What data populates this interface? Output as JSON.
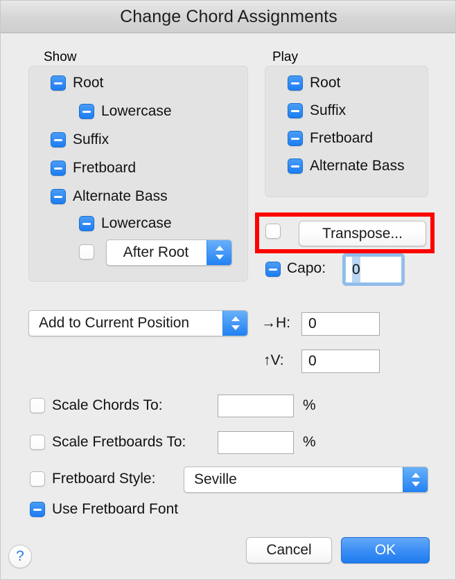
{
  "window": {
    "title": "Change Chord Assignments"
  },
  "show_group": {
    "label": "Show",
    "items": [
      {
        "label": "Root",
        "state": "mixed"
      },
      {
        "label": "Lowercase",
        "state": "mixed"
      },
      {
        "label": "Suffix",
        "state": "mixed"
      },
      {
        "label": "Fretboard",
        "state": "mixed"
      },
      {
        "label": "Alternate Bass",
        "state": "mixed"
      },
      {
        "label": "Lowercase",
        "state": "mixed"
      }
    ],
    "bass_position": {
      "checkbox_state": "off",
      "selected": "After Root"
    }
  },
  "play_group": {
    "label": "Play",
    "items": [
      {
        "label": "Root",
        "state": "mixed"
      },
      {
        "label": "Suffix",
        "state": "mixed"
      },
      {
        "label": "Fretboard",
        "state": "mixed"
      },
      {
        "label": "Alternate Bass",
        "state": "mixed"
      }
    ]
  },
  "transpose": {
    "checkbox_state": "off",
    "button_label": "Transpose...",
    "highlight_color": "#ff0000"
  },
  "capo": {
    "checkbox_state": "mixed",
    "label": "Capo:",
    "value": "0"
  },
  "position": {
    "mode_selected": "Add to Current Position",
    "h_label": "→H:",
    "h_value": "0",
    "v_label": "↑V:",
    "v_value": "0"
  },
  "scale_chords": {
    "checkbox_state": "off",
    "label": "Scale Chords To:",
    "value": "",
    "unit": "%"
  },
  "scale_fretboards": {
    "checkbox_state": "off",
    "label": "Scale Fretboards To:",
    "value": "",
    "unit": "%"
  },
  "fretboard_style": {
    "checkbox_state": "off",
    "label": "Fretboard Style:",
    "selected": "Seville"
  },
  "use_fretboard_font": {
    "checkbox_state": "mixed",
    "label": "Use Fretboard Font"
  },
  "footer": {
    "help_label": "?",
    "cancel_label": "Cancel",
    "ok_label": "OK"
  }
}
